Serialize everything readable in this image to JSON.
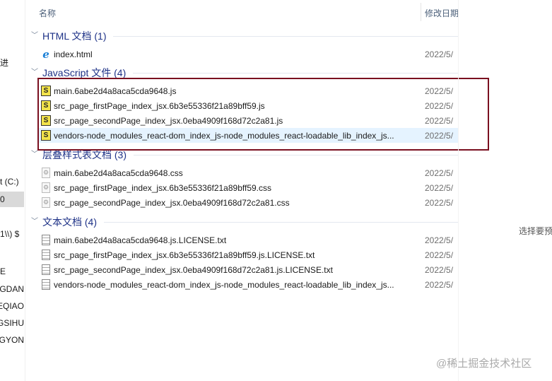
{
  "sidebar": {
    "items": [
      "进",
      "t (C:)",
      "0",
      "$ (\\\\1",
      "E",
      "GDAN",
      "EQIAO",
      "GSIHU",
      "GYON"
    ]
  },
  "columns": {
    "name": "名称",
    "modified": "修改日期"
  },
  "groups": [
    {
      "title": "HTML 文档 (1)",
      "icon": "ie-html-icon",
      "files": [
        {
          "name": "index.html",
          "date": "2022/5/"
        }
      ]
    },
    {
      "title": "JavaScript 文件 (4)",
      "icon": "js-file-icon",
      "files": [
        {
          "name": "main.6abe2d4a8aca5cda9648.js",
          "date": "2022/5/"
        },
        {
          "name": "src_page_firstPage_index_jsx.6b3e55336f21a89bff59.js",
          "date": "2022/5/"
        },
        {
          "name": "src_page_secondPage_index_jsx.0eba4909f168d72c2a81.js",
          "date": "2022/5/"
        },
        {
          "name": "vendors-node_modules_react-dom_index_js-node_modules_react-loadable_lib_index_js...",
          "date": "2022/5/"
        }
      ]
    },
    {
      "title": "层叠样式表文档 (3)",
      "icon": "css-file-icon",
      "files": [
        {
          "name": "main.6abe2d4a8aca5cda9648.css",
          "date": "2022/5/"
        },
        {
          "name": "src_page_firstPage_index_jsx.6b3e55336f21a89bff59.css",
          "date": "2022/5/"
        },
        {
          "name": "src_page_secondPage_index_jsx.0eba4909f168d72c2a81.css",
          "date": "2022/5/"
        }
      ]
    },
    {
      "title": "文本文档 (4)",
      "icon": "text-file-icon",
      "files": [
        {
          "name": "main.6abe2d4a8aca5cda9648.js.LICENSE.txt",
          "date": "2022/5/"
        },
        {
          "name": "src_page_firstPage_index_jsx.6b3e55336f21a89bff59.js.LICENSE.txt",
          "date": "2022/5/"
        },
        {
          "name": "src_page_secondPage_index_jsx.0eba4909f168d72c2a81.js.LICENSE.txt",
          "date": "2022/5/"
        },
        {
          "name": "vendors-node_modules_react-dom_index_js-node_modules_react-loadable_lib_index_js...",
          "date": "2022/5/"
        }
      ]
    }
  ],
  "preview_text": "选择要预",
  "watermark": "@稀土掘金技术社区",
  "colors": {
    "group_title": "#1e3287",
    "highlight_box": "#7a1020",
    "selected_row": "#e5f3ff"
  }
}
